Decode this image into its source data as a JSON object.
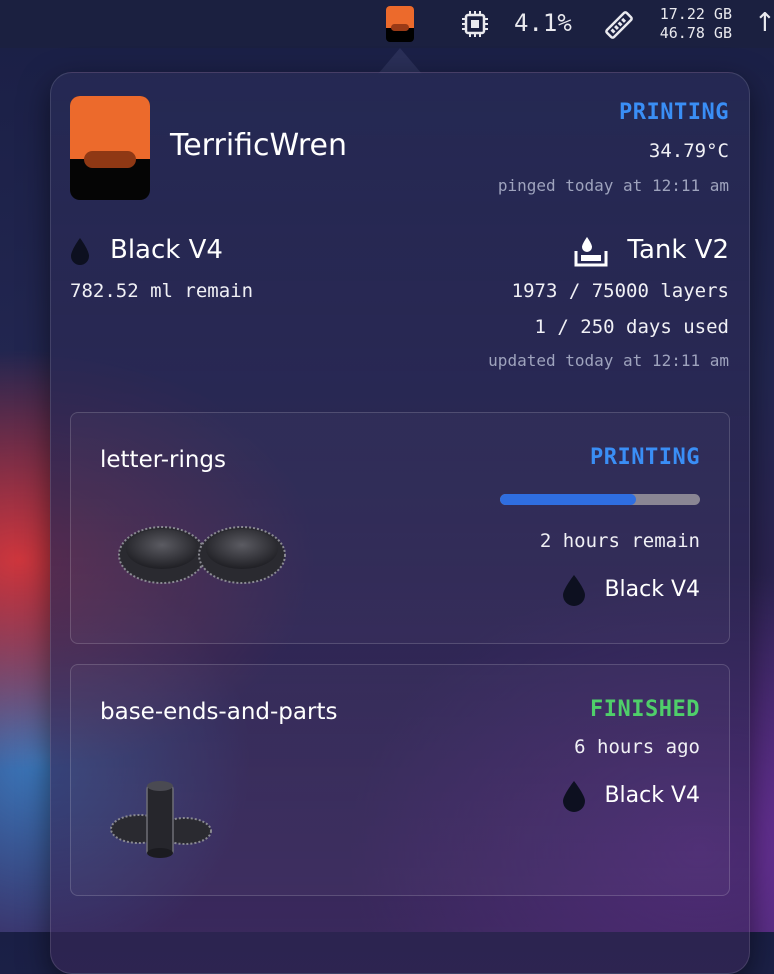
{
  "menubar": {
    "app_icon": "formlabs-printer-icon",
    "cpu_icon": "cpu-chip-icon",
    "cpu_usage": "4.1%",
    "memory_icon": "memory-stick-icon",
    "memory_used": "17.22 GB",
    "memory_free": "46.78 GB",
    "network_icon": "up-arrow-icon",
    "network_glyph": "↑↓"
  },
  "printer": {
    "name": "TerrificWren",
    "status": "PRINTING",
    "temperature": "34.79°C",
    "pinged": "pinged today at 12:11 am",
    "logo_colors": {
      "top": "#ec6a2c",
      "bottom": "#050505",
      "pill": "#8f3814"
    }
  },
  "resin": {
    "name": "Black V4",
    "remaining": "782.52 ml remain"
  },
  "tank": {
    "name": "Tank V2",
    "layers": "1973 / 75000 layers",
    "days": "1 / 250 days used",
    "updated": "updated today at 12:11 am"
  },
  "jobs": [
    {
      "name": "letter-rings",
      "status": "PRINTING",
      "status_color": "#3a8ef5",
      "progress": 0.68,
      "time": "2 hours remain",
      "resin": "Black V4"
    },
    {
      "name": "base-ends-and-parts",
      "status": "FINISHED",
      "status_color": "#4fcf6a",
      "time": "6 hours ago",
      "resin": "Black V4"
    }
  ]
}
